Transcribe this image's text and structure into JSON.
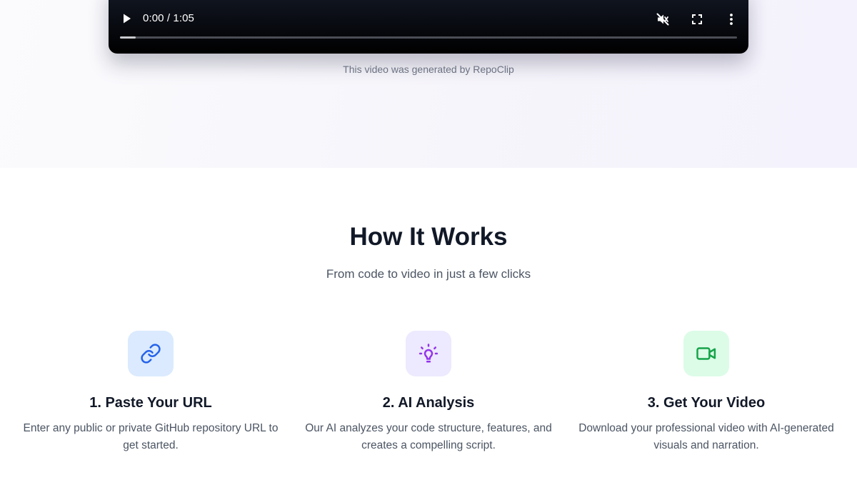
{
  "video": {
    "time": "0:00 / 1:05",
    "progress_fraction": 0.025,
    "caption": "This video was generated by RepoClip",
    "controls": [
      "play-icon",
      "mute-icon",
      "fullscreen-icon",
      "more-options-icon"
    ]
  },
  "how_it_works": {
    "title": "How It Works",
    "subtitle": "From code to video in just a few clicks",
    "steps": [
      {
        "title": "1. Paste Your URL",
        "description": "Enter any public or private GitHub repository URL to get started.",
        "icon": "link-icon",
        "icon_color": "#2563eb",
        "icon_bg": "#dbeafe"
      },
      {
        "title": "2. AI Analysis",
        "description": "Our AI analyzes your code structure, features, and creates a compelling script.",
        "icon": "lightbulb-icon",
        "icon_color": "#9333ea",
        "icon_bg": "#ede9fe"
      },
      {
        "title": "3. Get Your Video",
        "description": "Download your professional video with AI-generated visuals and narration.",
        "icon": "video-camera-icon",
        "icon_color": "#16a34a",
        "icon_bg": "#dcfce7"
      }
    ]
  }
}
